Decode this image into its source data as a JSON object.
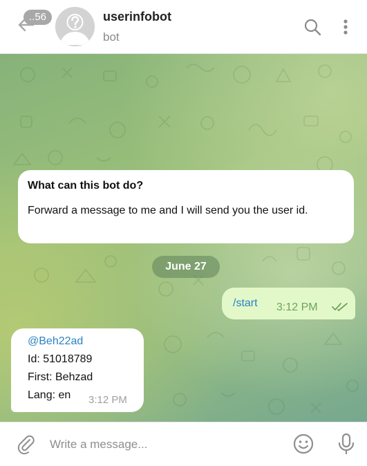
{
  "header": {
    "unread_count": "..56",
    "title": "userinfobot",
    "subtitle": "bot",
    "icons": {
      "back": "arrow-left-icon",
      "avatar": "question-mark-avatar",
      "search": "search-icon",
      "menu": "more-vertical-icon"
    }
  },
  "info_card": {
    "title": "What can this bot do?",
    "body": "Forward a message to me and I will send you the user id."
  },
  "date_separator": "June 27",
  "messages": [
    {
      "direction": "outgoing",
      "text": "/start",
      "time": "3:12 PM",
      "status": "double-check-icon"
    },
    {
      "direction": "incoming",
      "lines": [
        "@Beh22ad",
        "Id: 51018789",
        "First: Behzad",
        "Lang: en"
      ],
      "time": "3:12 PM"
    }
  ],
  "composer": {
    "placeholder": "Write a message...",
    "icons": {
      "attach": "paperclip-icon",
      "emoji": "smile-icon",
      "mic": "microphone-icon"
    }
  },
  "colors": {
    "outgoing_bubble": "#e3f8c9",
    "incoming_bubble": "#ffffff",
    "link": "#2b82c4",
    "outgoing_meta": "#6ea35d",
    "badge": "#a8a8a8"
  }
}
